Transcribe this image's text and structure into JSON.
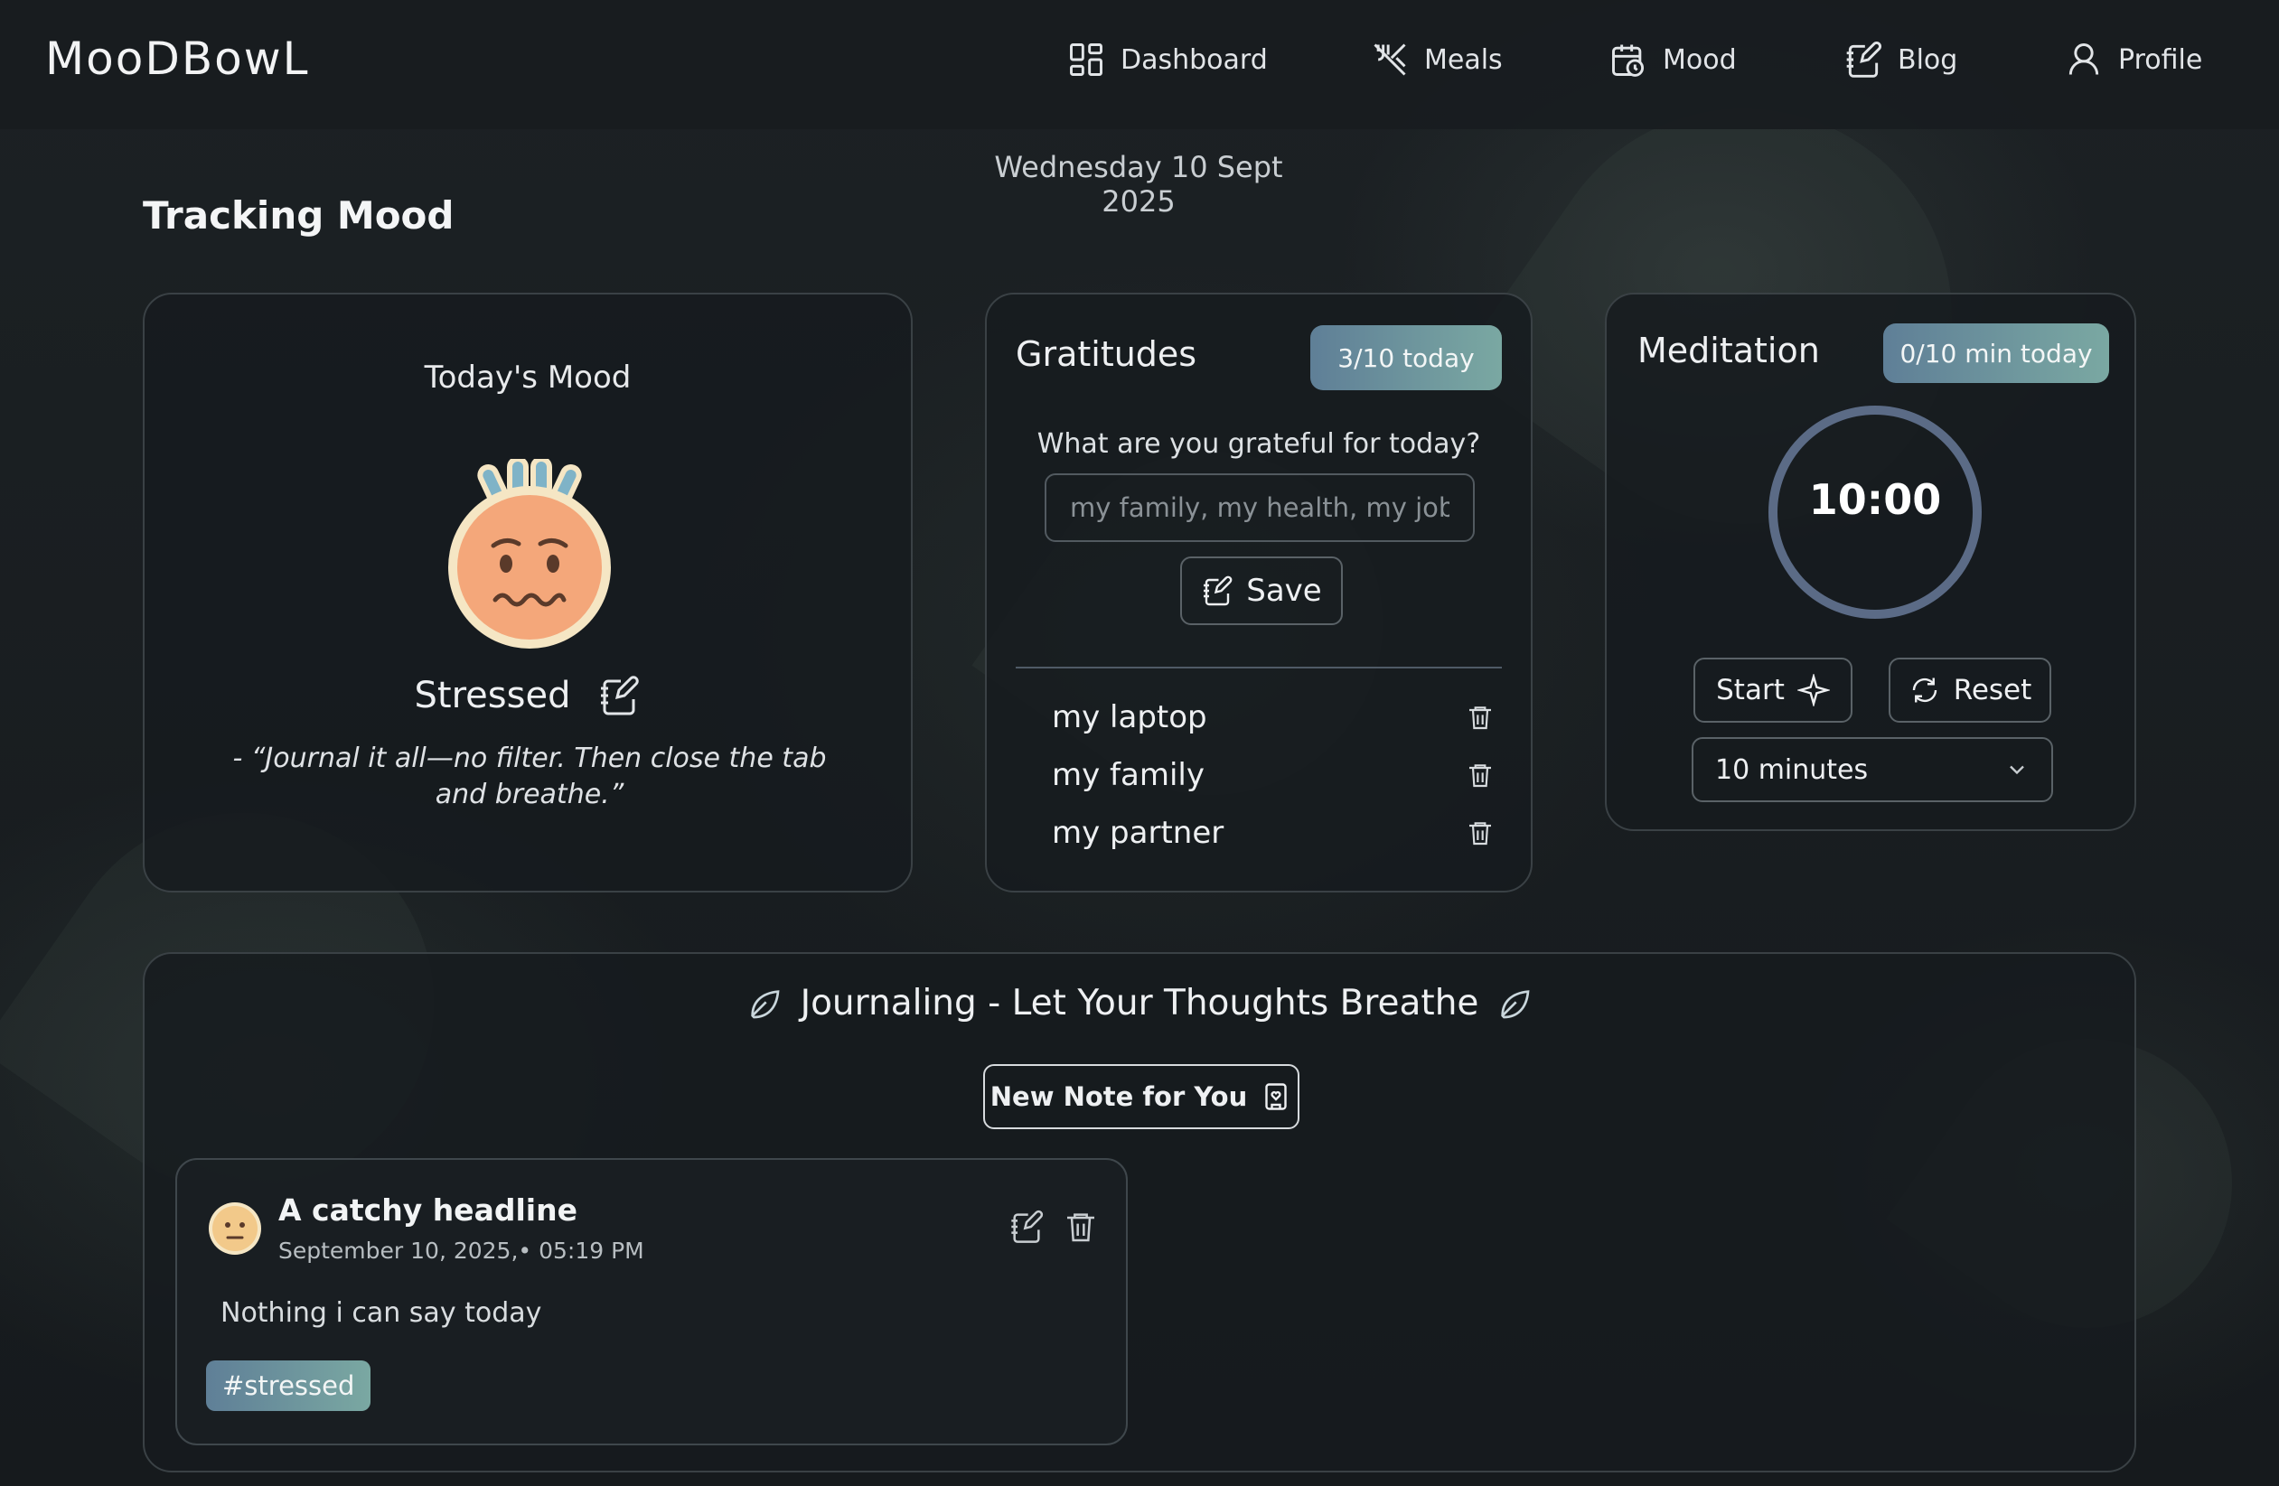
{
  "app": {
    "logo": "MooDBowL"
  },
  "nav": {
    "items": [
      {
        "label": "Dashboard",
        "icon": "dashboard-icon"
      },
      {
        "label": "Meals",
        "icon": "utensils-icon"
      },
      {
        "label": "Mood",
        "icon": "calendar-clock-icon"
      },
      {
        "label": "Blog",
        "icon": "notebook-pen-icon"
      },
      {
        "label": "Profile",
        "icon": "user-icon"
      }
    ]
  },
  "page": {
    "date": "Wednesday 10 Sept 2025",
    "title": "Tracking Mood"
  },
  "mood": {
    "heading": "Today's Mood",
    "label": "Stressed",
    "quote": "- “Journal it all—no filter. Then close the tab and breathe.”",
    "face_color": "#f4a77a"
  },
  "gratitudes": {
    "title": "Gratitudes",
    "badge": "3/10 today",
    "prompt": "What are you grateful for today?",
    "input_placeholder": "my family, my health, my job...",
    "save_label": "Save",
    "items": [
      {
        "label": "my laptop"
      },
      {
        "label": "my family"
      },
      {
        "label": "my partner"
      }
    ]
  },
  "meditation": {
    "title": "Meditation",
    "badge": "0/10 min today",
    "timer": "10:00",
    "start_label": "Start",
    "reset_label": "Reset",
    "duration_selected": "10 minutes"
  },
  "journal": {
    "title": "Journaling - Let Your Thoughts Breathe",
    "new_note_label": "New Note for You",
    "notes": [
      {
        "title": "A catchy headline",
        "date": "September 10, 2025,• 05:19 PM",
        "body": "Nothing i can say today",
        "tag": "#stressed"
      }
    ]
  },
  "colors": {
    "accent_gradient_start": "#5f7f97",
    "accent_gradient_end": "#7aa8a2",
    "timer_ring": "#5b6b86",
    "background": "#15191c"
  }
}
